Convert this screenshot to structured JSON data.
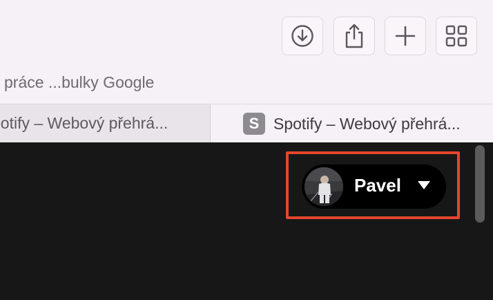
{
  "toolbar": {
    "buttons": [
      {
        "id": "download",
        "icon": "download-icon"
      },
      {
        "id": "share",
        "icon": "share-icon"
      },
      {
        "id": "new-tab",
        "icon": "plus-icon"
      },
      {
        "id": "tab-overview",
        "icon": "grid-icon"
      }
    ]
  },
  "bookmarks": {
    "item_label": "práce ...bulky Google"
  },
  "tabs": [
    {
      "title": "potify – Webový přehrá...",
      "active": true
    },
    {
      "title": "Spotify – Webový přehrá...",
      "active": false,
      "favicon_letter": "S"
    }
  ],
  "user_menu": {
    "name": "Pavel",
    "highlight_color": "#e4462c"
  },
  "colors": {
    "chrome_bg": "#f6f1f6",
    "content_bg": "#171717",
    "pill_bg": "#000000"
  }
}
